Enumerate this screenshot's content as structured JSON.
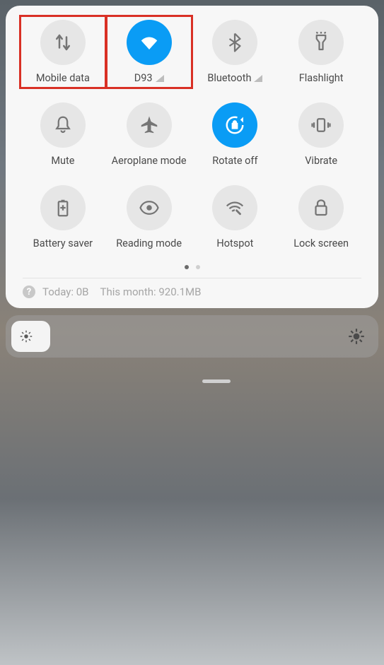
{
  "tiles": [
    {
      "label": "Mobile data",
      "active": false,
      "highlighted": true,
      "signal": false
    },
    {
      "label": "D93",
      "active": true,
      "highlighted": true,
      "signal": true
    },
    {
      "label": "Bluetooth",
      "active": false,
      "highlighted": false,
      "signal": true
    },
    {
      "label": "Flashlight",
      "active": false,
      "highlighted": false,
      "signal": false
    },
    {
      "label": "Mute",
      "active": false,
      "highlighted": false,
      "signal": false
    },
    {
      "label": "Aeroplane mode",
      "active": false,
      "highlighted": false,
      "signal": false
    },
    {
      "label": "Rotate off",
      "active": true,
      "highlighted": false,
      "signal": false
    },
    {
      "label": "Vibrate",
      "active": false,
      "highlighted": false,
      "signal": false
    },
    {
      "label": "Battery saver",
      "active": false,
      "highlighted": false,
      "signal": false
    },
    {
      "label": "Reading mode",
      "active": false,
      "highlighted": false,
      "signal": false
    },
    {
      "label": "Hotspot",
      "active": false,
      "highlighted": false,
      "signal": false
    },
    {
      "label": "Lock screen",
      "active": false,
      "highlighted": false,
      "signal": false
    }
  ],
  "dataUsage": {
    "today": "Today: 0B",
    "month": "This month: 920.1MB",
    "helpGlyph": "?"
  },
  "colors": {
    "accent": "#0a9cf5",
    "highlight": "#d93025"
  }
}
